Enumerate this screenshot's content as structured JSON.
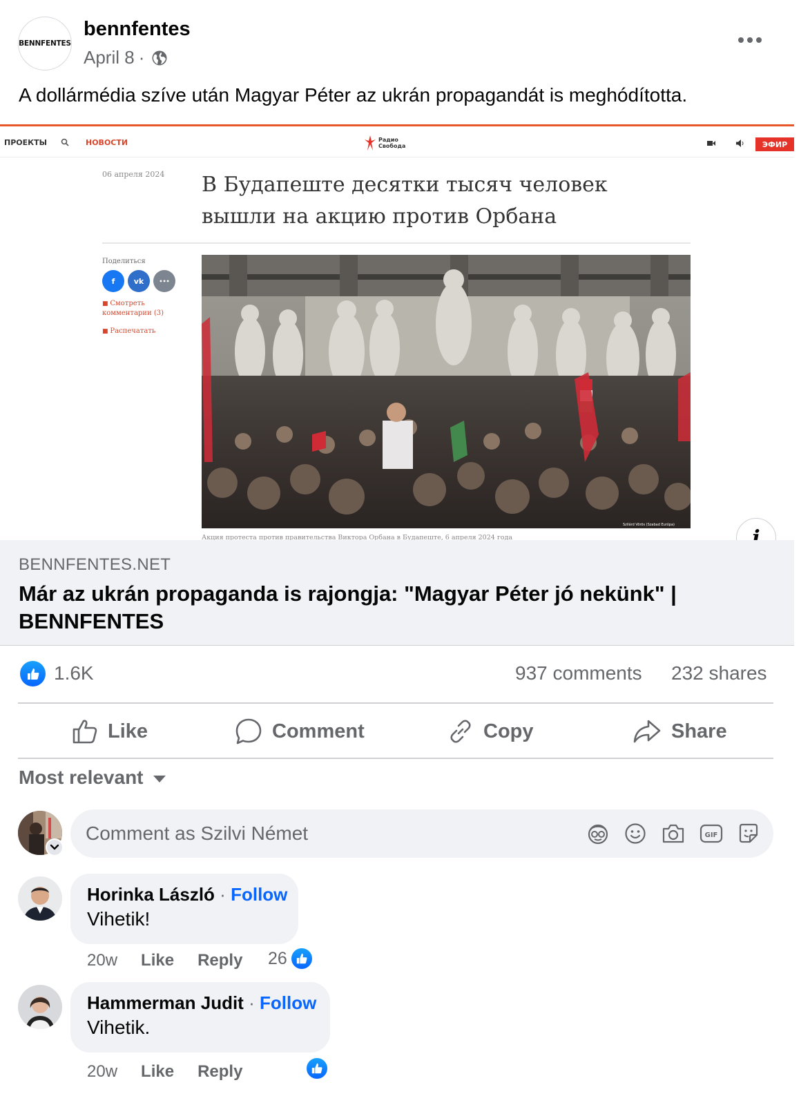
{
  "post": {
    "page_name": "bennfentes",
    "avatar_text": "BENNFENTES",
    "date": "April 8",
    "separator": "·",
    "audience_icon": "globe-icon",
    "more_icon": "more-horizontal-icon",
    "text": "A dollármédia szíve után Magyar Péter az ukrán propagandát is meghódította."
  },
  "link_preview": {
    "screenshot": {
      "nav_projects": "ПРОЕКТЫ",
      "nav_news": "НОВОСТИ",
      "logo_line1": "Радио",
      "logo_line2": "Свобода",
      "live_label": "ЭФИР",
      "date": "06 апреля 2024",
      "headline": "В Будапеште десятки тысяч человек вышли на акцию против Орбана",
      "share_label": "Поделиться",
      "share_fb": "f",
      "share_vk": "vk",
      "share_more": "•••",
      "comments_link": "Смотреть комментарии (3)",
      "print_link": "Распечатать",
      "photo_credit": "Szilárd Vörös (Szabad Európa)",
      "caption": "Акция протеста против правительства Виктора Орбана в Будапеште, 6 апреля 2024 года"
    },
    "info_icon": "i",
    "domain": "BENNFENTES.NET",
    "title": "Már az ukrán propaganda is rajongja: \"Magyar Péter jó nekünk\" | BENNFENTES"
  },
  "stats": {
    "reactions": "1.6K",
    "comments": "937 comments",
    "shares": "232 shares"
  },
  "actions": {
    "like": "Like",
    "comment": "Comment",
    "copy": "Copy",
    "share": "Share"
  },
  "sort": {
    "label": "Most relevant"
  },
  "composer": {
    "placeholder": "Comment as Szilvi Német",
    "icons": [
      "avatar-sticker-icon",
      "emoji-icon",
      "camera-icon",
      "gif-icon",
      "sticker-icon"
    ]
  },
  "comments": [
    {
      "author": "Horinka László",
      "dot": "·",
      "follow": "Follow",
      "text": "Vihetik!",
      "time": "20w",
      "like": "Like",
      "reply": "Reply",
      "reaction_count": "26"
    },
    {
      "author": "Hammerman Judit",
      "dot": "·",
      "follow": "Follow",
      "text": "Vihetik.",
      "time": "20w",
      "like": "Like",
      "reply": "Reply",
      "reaction_count": ""
    }
  ],
  "colors": {
    "accent_blue": "#0866ff",
    "secondary_text": "#65676b",
    "bubble_bg": "#f0f2f5",
    "rs_red": "#e5332a"
  }
}
